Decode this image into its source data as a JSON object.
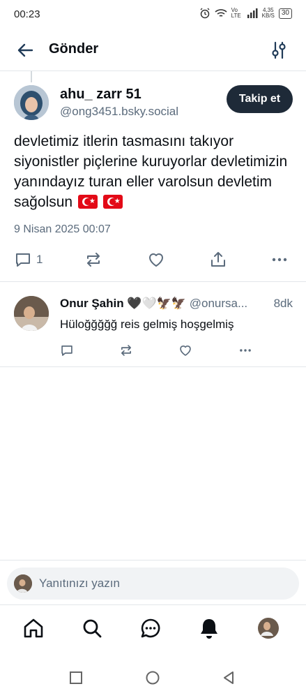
{
  "status_bar": {
    "time": "00:23",
    "network_label": "Vo LTE",
    "speed_value": "4,35",
    "speed_unit": "KB/S",
    "battery": "30"
  },
  "header": {
    "title": "Gönder"
  },
  "post": {
    "display_name": "ahu_ zarr 51",
    "handle": "@ong3451.bsky.social",
    "follow_label": "Takip et",
    "text": "devletimiz itlerin tasmasını takıyor siyonistler piçlerine kuruyorlar devletimizin yanındayız turan eller varolsun devletim sağolsun",
    "flags": [
      "turkey-flag",
      "turkey-flag"
    ],
    "date": "9 Nisan 2025 00:07",
    "reply_count": "1"
  },
  "reply": {
    "display_name": "Onur Şahin 🖤🤍🦅🦅",
    "handle": "@onursa...",
    "time": "8dk",
    "text": "Hüloğğğğğ reis gelmiş hoşgelmiş"
  },
  "composer": {
    "placeholder": "Yanıtınızı yazın"
  },
  "colors": {
    "accent": "#1e2a38",
    "muted": "#5b6b7c",
    "divider": "#e3e6ea"
  }
}
